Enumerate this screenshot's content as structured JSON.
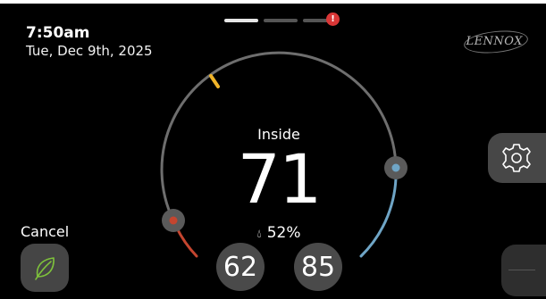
{
  "status": {
    "time": "7:50am",
    "date": "Tue, Dec 9th, 2025",
    "brand": "LENNOX"
  },
  "pager": {
    "pages": 3,
    "active_index": 0,
    "alert_badge": "!"
  },
  "thermostat": {
    "label": "Inside",
    "temperature": "71",
    "humidity": "52%",
    "heat_setpoint": "62",
    "cool_setpoint": "85"
  },
  "controls": {
    "cancel_label": "Cancel",
    "eco_icon": "leaf-icon",
    "settings_icon": "gear-icon"
  },
  "colors": {
    "heat": "#c4452f",
    "cool": "#6fa5c6",
    "marker": "#f0b429",
    "alert": "#d93636",
    "leaf": "#7ec23b"
  }
}
